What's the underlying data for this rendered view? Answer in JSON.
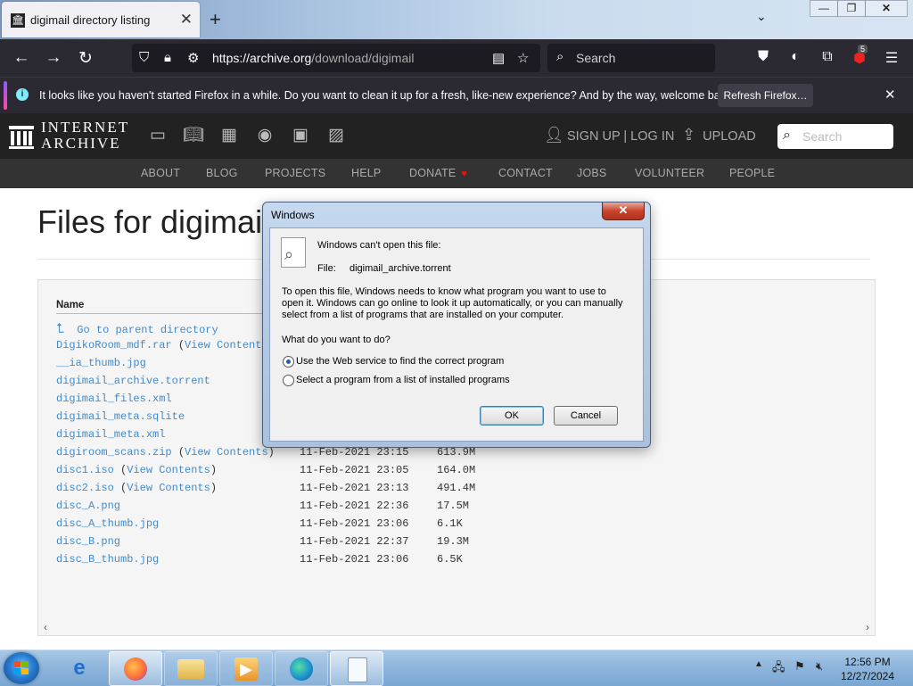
{
  "browser": {
    "tab_title": "digimail directory listing",
    "new_tab_label": "+",
    "url_host": "https://archive.org",
    "url_path": "/download/digimail",
    "search_placeholder": "Search",
    "extension_badge": "5",
    "window_controls": {
      "minimize": "—",
      "restore": "❐",
      "close": "✕"
    }
  },
  "notification": {
    "message": "It looks like you haven't started Firefox in a while. Do you want to clean it up for a fresh, like-new experience? And by the way, welcome back!",
    "button": "Refresh Firefox…"
  },
  "ia": {
    "logo_line1": "INTERNET",
    "logo_line2": "ARCHIVE",
    "signup": "SIGN UP | LOG IN",
    "upload": "UPLOAD",
    "search_placeholder": "Search",
    "nav": [
      "ABOUT",
      "BLOG",
      "PROJECTS",
      "HELP",
      "DONATE",
      "CONTACT",
      "JOBS",
      "VOLUNTEER",
      "PEOPLE"
    ]
  },
  "page": {
    "title": "Files for digimail",
    "column_name": "Name",
    "parent_link": "Go to parent directory",
    "files": [
      {
        "name": "DigikoRoom_mdf.rar",
        "extra": "View Contents",
        "date": "",
        "size": ""
      },
      {
        "name": "__ia_thumb.jpg",
        "extra": "",
        "date": "",
        "size": ""
      },
      {
        "name": "digimail_archive.torrent",
        "extra": "",
        "date": "",
        "size": ""
      },
      {
        "name": "digimail_files.xml",
        "extra": "",
        "date": "",
        "size": ""
      },
      {
        "name": "digimail_meta.sqlite",
        "extra": "",
        "date": "",
        "size": ""
      },
      {
        "name": "digimail_meta.xml",
        "extra": "",
        "date": "",
        "size": ""
      },
      {
        "name": "digiroom_scans.zip",
        "extra": "View Contents",
        "date": "11-Feb-2021 23:15",
        "size": "613.9M"
      },
      {
        "name": "disc1.iso",
        "extra": "View Contents",
        "date": "11-Feb-2021 23:05",
        "size": "164.0M"
      },
      {
        "name": "disc2.iso",
        "extra": "View Contents",
        "date": "11-Feb-2021 23:13",
        "size": "491.4M"
      },
      {
        "name": "disc_A.png",
        "extra": "",
        "date": "11-Feb-2021 22:36",
        "size": "17.5M"
      },
      {
        "name": "disc_A_thumb.jpg",
        "extra": "",
        "date": "11-Feb-2021 23:06",
        "size": "6.1K"
      },
      {
        "name": "disc_B.png",
        "extra": "",
        "date": "11-Feb-2021 22:37",
        "size": "19.3M"
      },
      {
        "name": "disc_B_thumb.jpg",
        "extra": "",
        "date": "11-Feb-2021 23:06",
        "size": "6.5K"
      }
    ]
  },
  "dialog": {
    "title": "Windows",
    "close": "✕",
    "heading": "Windows can't open this file:",
    "file_label": "File:",
    "file_name": "digimail_archive.torrent",
    "body_line1": "To open this file, Windows needs to know what program you want to use to",
    "body_line2": "open it. Windows can go online to look it up automatically, or you can manually",
    "body_line3": "select from a list of programs that are installed on your computer.",
    "question": "What do you want to do?",
    "option1": "Use the Web service to find the correct program",
    "option2": "Select a program from a list of installed programs",
    "ok": "OK",
    "cancel": "Cancel"
  },
  "taskbar": {
    "time": "12:56 PM",
    "date": "12/27/2024"
  }
}
